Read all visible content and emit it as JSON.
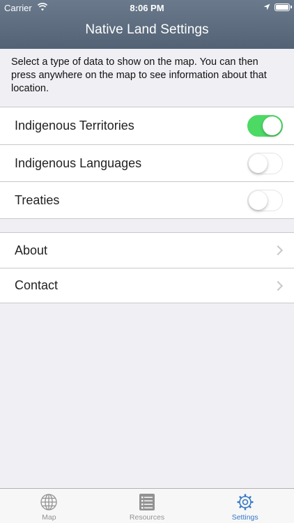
{
  "status_bar": {
    "carrier": "Carrier",
    "time": "8:06 PM"
  },
  "header": {
    "title": "Native Land Settings"
  },
  "intro_text": "Select a type of data to show on the map. You can then press anywhere on the map to see information about that location.",
  "layers": [
    {
      "label": "Indigenous Territories",
      "enabled": true
    },
    {
      "label": "Indigenous Languages",
      "enabled": false
    },
    {
      "label": "Treaties",
      "enabled": false
    }
  ],
  "links": [
    {
      "label": "About"
    },
    {
      "label": "Contact"
    }
  ],
  "tabbar": {
    "tabs": [
      {
        "label": "Map",
        "icon": "globe-icon",
        "active": false
      },
      {
        "label": "Resources",
        "icon": "list-icon",
        "active": false
      },
      {
        "label": "Settings",
        "icon": "gear-icon",
        "active": true
      }
    ]
  },
  "colors": {
    "header": "#5d6c7f",
    "toggle_on": "#4cd964",
    "tab_active": "#3478c8",
    "tab_inactive": "#929292"
  }
}
